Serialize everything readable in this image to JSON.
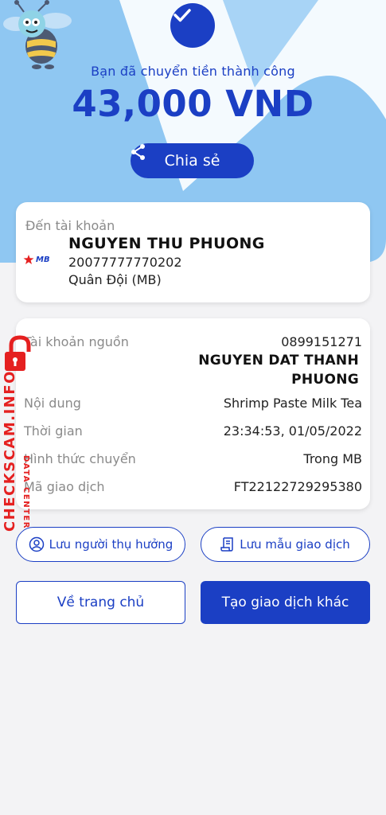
{
  "header": {
    "success_text": "Bạn đã chuyển tiền thành công",
    "amount": "43,000 VND",
    "share_label": "Chia sẻ"
  },
  "destination": {
    "label": "Đến tài khoản",
    "bank_logo_text": "MB",
    "name": "NGUYEN THU PHUONG",
    "account": "20077777770202",
    "bank": "Quân Đội (MB)"
  },
  "details": {
    "source_label": "Tài khoản nguồn",
    "source_account": "0899151271",
    "source_name_line1": "NGUYEN DAT THANH",
    "source_name_line2": "PHUONG",
    "content_label": "Nội dung",
    "content_value": "Shrimp Paste Milk Tea",
    "time_label": "Thời gian",
    "time_value": "23:34:53, 01/05/2022",
    "method_label": "Hình thức chuyển",
    "method_value": "Trong MB",
    "ref_label": "Mã giao dịch",
    "ref_value": "FT22122729295380"
  },
  "actions": {
    "save_beneficiary": "Lưu người thụ hưởng",
    "save_template": "Lưu mẫu giao dịch",
    "home": "Về trang chủ",
    "new_transaction": "Tạo giao dịch khác"
  },
  "watermark": {
    "main": "CHECKSCAM.INFO",
    "sub": "DATA CENTER"
  },
  "colors": {
    "primary": "#1b3fc4",
    "hero_bg": "#8ec6f2",
    "watermark": "#e52020"
  }
}
